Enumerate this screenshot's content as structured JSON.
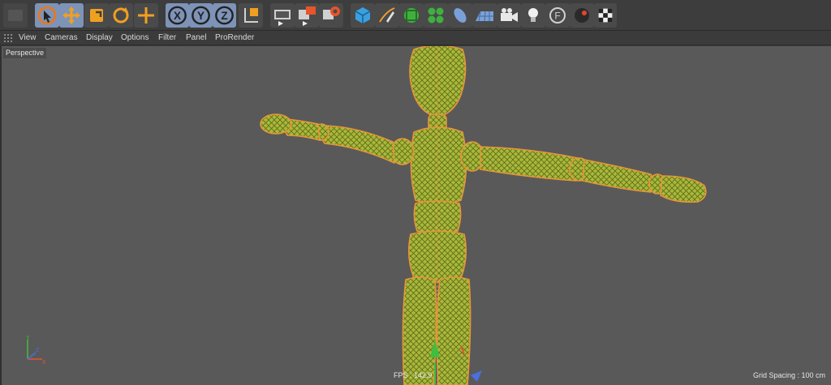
{
  "toolbar": {
    "tools": [
      {
        "name": "undo-icon",
        "state": "dim"
      },
      {
        "name": "select-icon",
        "state": "active"
      },
      {
        "name": "move-icon",
        "state": "active"
      },
      {
        "name": "scale-icon",
        "state": "normal"
      },
      {
        "name": "rotate-icon",
        "state": "normal"
      },
      {
        "name": "transform-icon",
        "state": "normal"
      },
      {
        "name": "x-axis-lock-icon",
        "label": "X",
        "state": "active"
      },
      {
        "name": "y-axis-lock-icon",
        "label": "Y",
        "state": "active"
      },
      {
        "name": "z-axis-lock-icon",
        "label": "Z",
        "state": "active"
      },
      {
        "name": "coordinate-system-icon",
        "state": "normal"
      },
      {
        "name": "render-view-icon",
        "state": "normal"
      },
      {
        "name": "render-to-picture-viewer-icon",
        "state": "normal"
      },
      {
        "name": "render-settings-icon",
        "state": "normal"
      },
      {
        "name": "cube-icon",
        "state": "normal"
      },
      {
        "name": "pen-icon",
        "state": "normal"
      },
      {
        "name": "subdivision-icon",
        "state": "normal"
      },
      {
        "name": "cloner-icon",
        "state": "normal"
      },
      {
        "name": "deformer-icon",
        "state": "normal"
      },
      {
        "name": "floor-icon",
        "state": "normal"
      },
      {
        "name": "camera-icon",
        "state": "normal"
      },
      {
        "name": "light-icon",
        "state": "normal"
      },
      {
        "name": "field-icon",
        "state": "normal"
      },
      {
        "name": "material-icon",
        "state": "normal"
      },
      {
        "name": "checker-tag-icon",
        "state": "normal"
      }
    ]
  },
  "menu": {
    "view": "View",
    "cameras": "Cameras",
    "display": "Display",
    "options": "Options",
    "filter": "Filter",
    "panel": "Panel",
    "prorender": "ProRender"
  },
  "viewport": {
    "label": "Perspective",
    "fps": "FPS : 142.9",
    "grid_spacing": "Grid Spacing : 100 cm"
  },
  "colors": {
    "viewport_bg": "#595959",
    "mesh_fill": "#a9b83b",
    "mesh_outline": "#e8953a",
    "active_tool": "#7d93b8",
    "axis_x": "#e8503a",
    "axis_y": "#3fbf3f",
    "axis_z": "#4a6fe0"
  }
}
